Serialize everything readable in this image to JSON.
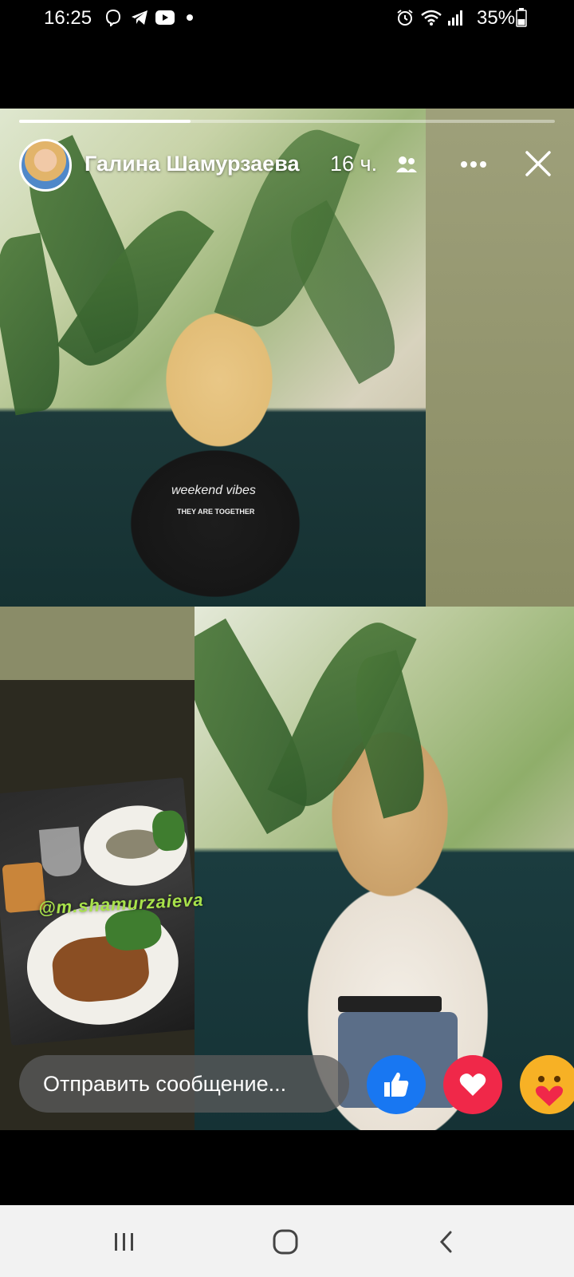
{
  "status_bar": {
    "time": "16:25",
    "battery": "35%",
    "icons": [
      "viber-icon",
      "telegram-icon",
      "youtube-icon",
      "dot-icon",
      "alarm-icon",
      "wifi-icon",
      "signal-icon",
      "battery-icon"
    ]
  },
  "story": {
    "author": "Галина Шамурзаева",
    "time_ago": "16 ч.",
    "audience_icon": "friends-icon",
    "progress": 0.32,
    "handle_text": "@m.shamurzaieva",
    "photo_text": [
      "weekend vibes",
      "THEY ARE TOGETHER"
    ]
  },
  "composer": {
    "placeholder": "Отправить сообщение..."
  },
  "reactions": [
    "like-icon",
    "love-icon",
    "care-icon"
  ],
  "colors": {
    "like": "#1877f2",
    "love": "#f02849",
    "care": "#f7b125",
    "story_bg": "#8a8c68"
  },
  "nav": [
    "recent-apps-icon",
    "home-icon",
    "back-icon"
  ]
}
